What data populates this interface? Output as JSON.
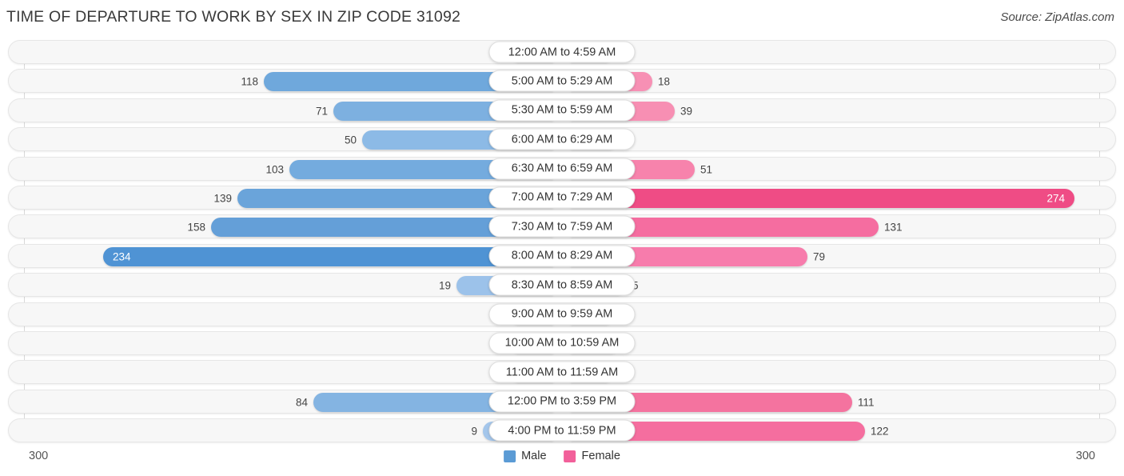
{
  "header": {
    "title": "TIME OF DEPARTURE TO WORK BY SEX IN ZIP CODE 31092",
    "source": "Source: ZipAtlas.com"
  },
  "legend": {
    "male_label": "Male",
    "female_label": "Female",
    "male_color": "#5b9bd5",
    "female_color": "#f2609a"
  },
  "axis": {
    "left_label": "300",
    "right_label": "300"
  },
  "chart_data": {
    "type": "bar",
    "orientation": "horizontal-diverging",
    "title": "TIME OF DEPARTURE TO WORK BY SEX IN ZIP CODE 31092",
    "xlabel": "",
    "ylabel": "",
    "xlim": [
      300,
      300
    ],
    "axis_max": 300,
    "grid": true,
    "legend_position": "bottom-center",
    "categories": [
      "12:00 AM to 4:59 AM",
      "5:00 AM to 5:29 AM",
      "5:30 AM to 5:59 AM",
      "6:00 AM to 6:29 AM",
      "6:30 AM to 6:59 AM",
      "7:00 AM to 7:29 AM",
      "7:30 AM to 7:59 AM",
      "8:00 AM to 8:29 AM",
      "8:30 AM to 8:59 AM",
      "9:00 AM to 9:59 AM",
      "10:00 AM to 10:59 AM",
      "11:00 AM to 11:59 AM",
      "12:00 PM to 3:59 PM",
      "4:00 PM to 11:59 PM"
    ],
    "series": [
      {
        "name": "Male",
        "values": [
          0,
          118,
          71,
          50,
          103,
          139,
          158,
          234,
          19,
          0,
          0,
          0,
          84,
          9
        ]
      },
      {
        "name": "Female",
        "values": [
          0,
          18,
          39,
          2,
          51,
          274,
          131,
          79,
          5,
          0,
          3,
          0,
          111,
          122
        ]
      }
    ]
  },
  "rows": [
    {
      "label": "12:00 AM to 4:59 AM",
      "male": "0",
      "female": "0",
      "male_w": 55,
      "female_w": 55,
      "male_shade": "#a8c9ec",
      "female_shade": "#f7a8c6",
      "male_inside": false,
      "female_inside": false
    },
    {
      "label": "5:00 AM to 5:29 AM",
      "male": "118",
      "female": "18",
      "male_w": 362,
      "female_w": 102,
      "male_shade": "#6fa8dc",
      "female_shade": "#f790b4",
      "male_inside": false,
      "female_inside": false
    },
    {
      "label": "5:30 AM to 5:59 AM",
      "male": "71",
      "female": "39",
      "male_w": 275,
      "female_w": 130,
      "male_shade": "#7db0e0",
      "female_shade": "#f78fb3",
      "male_inside": false,
      "female_inside": false
    },
    {
      "label": "6:00 AM to 6:29 AM",
      "male": "50",
      "female": "2",
      "male_w": 239,
      "female_w": 60,
      "male_shade": "#8cbae6",
      "female_shade": "#f79ebe",
      "male_inside": false,
      "female_inside": false
    },
    {
      "label": "6:30 AM to 6:59 AM",
      "male": "103",
      "female": "51",
      "male_w": 330,
      "female_w": 155,
      "male_shade": "#74abde",
      "female_shade": "#f783ac",
      "male_inside": false,
      "female_inside": false
    },
    {
      "label": "7:00 AM to 7:29 AM",
      "male": "139",
      "female": "274",
      "male_w": 395,
      "female_w": 630,
      "male_shade": "#6aa4da",
      "female_shade": "#ef4c85",
      "male_inside": false,
      "female_inside": true
    },
    {
      "label": "7:30 AM to 7:59 AM",
      "male": "158",
      "female": "131",
      "male_w": 428,
      "female_w": 385,
      "male_shade": "#649fd8",
      "female_shade": "#f56da0",
      "male_inside": false,
      "female_inside": false
    },
    {
      "label": "8:00 AM to 8:29 AM",
      "male": "234",
      "female": "79",
      "male_w": 563,
      "female_w": 296,
      "male_shade": "#4f93d4",
      "female_shade": "#f77cac",
      "male_inside": true,
      "female_inside": false
    },
    {
      "label": "8:30 AM to 8:59 AM",
      "male": "19",
      "female": "5",
      "male_w": 121,
      "female_w": 70,
      "male_shade": "#9cc2ea",
      "female_shade": "#f795ba",
      "male_inside": false,
      "female_inside": false
    },
    {
      "label": "9:00 AM to 9:59 AM",
      "male": "0",
      "female": "0",
      "male_w": 55,
      "female_w": 55,
      "male_shade": "#a8c9ec",
      "female_shade": "#f7a0c1",
      "male_inside": false,
      "female_inside": false
    },
    {
      "label": "10:00 AM to 10:59 AM",
      "male": "0",
      "female": "3",
      "male_w": 55,
      "female_w": 62,
      "male_shade": "#a8c9ec",
      "female_shade": "#f79dbf",
      "male_inside": false,
      "female_inside": false
    },
    {
      "label": "11:00 AM to 11:59 AM",
      "male": "0",
      "female": "0",
      "male_w": 55,
      "female_w": 55,
      "male_shade": "#a8c9ec",
      "female_shade": "#f7a0c1",
      "male_inside": false,
      "female_inside": false
    },
    {
      "label": "12:00 PM to 3:59 PM",
      "male": "84",
      "female": "111",
      "male_w": 300,
      "female_w": 352,
      "male_shade": "#84b4e2",
      "female_shade": "#f4739f",
      "male_inside": false,
      "female_inside": false
    },
    {
      "label": "4:00 PM to 11:59 PM",
      "male": "9",
      "female": "122",
      "male_w": 88,
      "female_w": 368,
      "male_shade": "#a4c6eb",
      "female_shade": "#f56e9f",
      "male_inside": false,
      "female_inside": false
    }
  ]
}
